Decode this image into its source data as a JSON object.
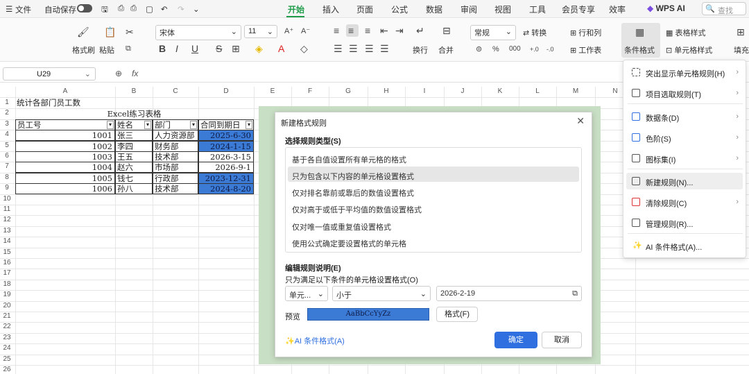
{
  "topbar": {
    "file": "文件",
    "autosave": "自动保存",
    "tabs": [
      "开始",
      "插入",
      "页面",
      "公式",
      "数据",
      "审阅",
      "视图",
      "工具",
      "会员专享",
      "效率"
    ],
    "wps_ai": "WPS AI",
    "search_placeholder": "查找"
  },
  "ribbon": {
    "format_painter": "格式刷",
    "paste": "粘贴",
    "font": "宋体",
    "font_size": "11",
    "number_format": "常规",
    "convert": "转换",
    "row_col": "行和列",
    "worksheet": "工作表",
    "cond_format": "条件格式",
    "table_style": "表格样式",
    "cell_style": "单元格样式",
    "wrap": "换行",
    "merge": "合并",
    "fill": "填充"
  },
  "formula_bar": {
    "cell_ref": "U29",
    "fx": "fx"
  },
  "columns": [
    "A",
    "B",
    "C",
    "D",
    "E",
    "F",
    "G",
    "H",
    "I",
    "J",
    "K",
    "L",
    "M",
    "N"
  ],
  "rows": [
    "1",
    "2",
    "3",
    "4",
    "5",
    "6",
    "7",
    "8",
    "9",
    "10",
    "11",
    "12",
    "13",
    "14",
    "15",
    "16",
    "17",
    "18",
    "19",
    "20",
    "21",
    "22",
    "23",
    "24",
    "25",
    "26"
  ],
  "sheet": {
    "title": "统计各部门员工数",
    "subtitle": "Excel练习表格",
    "headers": [
      "员工号",
      "姓名",
      "部门",
      "合同到期日"
    ],
    "data": [
      [
        "1001",
        "张三",
        "人力资源部",
        "2025-6-30"
      ],
      [
        "1002",
        "李四",
        "财务部",
        "2024-1-15"
      ],
      [
        "1003",
        "王五",
        "技术部",
        "2026-3-15"
      ],
      [
        "1004",
        "赵六",
        "市场部",
        "2026-9-1"
      ],
      [
        "1005",
        "钱七",
        "行政部",
        "2023-12-31"
      ],
      [
        "1006",
        "孙八",
        "技术部",
        "2024-8-20"
      ]
    ]
  },
  "dialog": {
    "title": "新建格式规则",
    "rule_type_label": "选择规则类型(S)",
    "rule_types": [
      "基于各自值设置所有单元格的格式",
      "只为包含以下内容的单元格设置格式",
      "仅对排名靠前或靠后的数值设置格式",
      "仅对高于或低于平均值的数值设置格式",
      "仅对唯一值或重复值设置格式",
      "使用公式确定要设置格式的单元格"
    ],
    "edit_label": "编辑规则说明(E)",
    "sub_label": "只为满足以下条件的单元格设置格式(O)",
    "cond1": "单元...",
    "cond2": "小于",
    "value": "2026-2-19",
    "preview_label": "预览",
    "preview_text": "AaBbCcYyZz",
    "format_btn": "格式(F)",
    "ai_link": "AI 条件格式(A)",
    "ok": "确定",
    "cancel": "取消"
  },
  "cf_menu": [
    "突出显示单元格规则(H)",
    "项目选取规则(T)",
    "数据条(D)",
    "色阶(S)",
    "图标集(I)",
    "新建规则(N)...",
    "清除规则(C)",
    "管理规则(R)...",
    "AI 条件格式(A)..."
  ],
  "colors": {
    "accent": "#1f9c4a",
    "highlight": "#3b7bd6",
    "primary_btn": "#2f6fe0"
  }
}
